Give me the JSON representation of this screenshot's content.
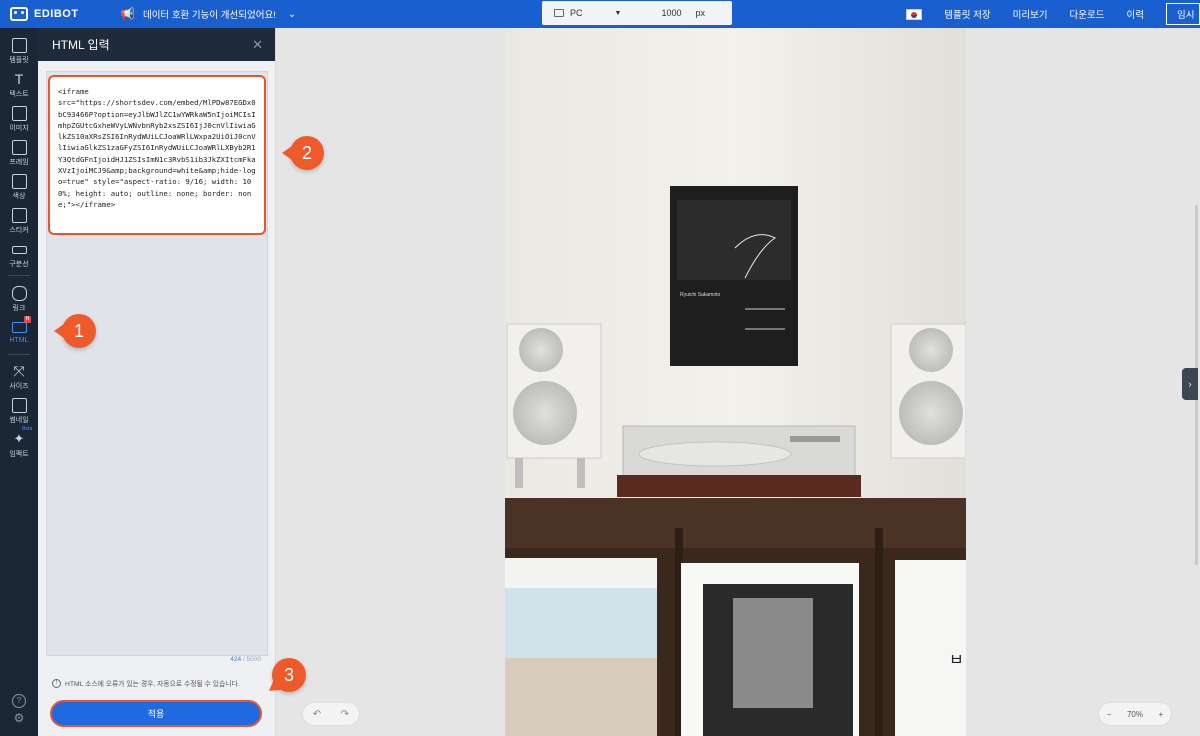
{
  "topbar": {
    "logo": "EDIBOT",
    "notice": "데이터 호환 기능이 개선되었어요!",
    "device": "PC",
    "width_value": "1000",
    "width_unit": "px",
    "actions": [
      "템플릿 저장",
      "미리보기",
      "다운로드",
      "이력",
      "임시"
    ]
  },
  "rail": {
    "items": [
      {
        "label": "템플릿",
        "icon": "template-icon"
      },
      {
        "label": "텍스트",
        "icon": "text-icon"
      },
      {
        "label": "이미지",
        "icon": "image-icon"
      },
      {
        "label": "프레임",
        "icon": "frame-icon"
      },
      {
        "label": "색상",
        "icon": "color-icon"
      },
      {
        "label": "스티커",
        "icon": "sticker-icon"
      },
      {
        "label": "구분선",
        "icon": "divider-icon"
      },
      {
        "label": "링크",
        "icon": "link-icon"
      },
      {
        "label": "HTML",
        "icon": "html-icon"
      },
      {
        "label": "사이즈",
        "icon": "size-icon"
      },
      {
        "label": "썸네일",
        "icon": "thumbnail-icon"
      },
      {
        "label": "임팩트",
        "icon": "impact-icon"
      }
    ],
    "html_badge": "N",
    "impact_badge": "Beta",
    "help": "?"
  },
  "panel": {
    "title": "HTML 입력",
    "code": "<iframe\nsrc=\"https://shortsdev.com/embed/MlPDw87EGDx0bC93466P?option=eyJlbWJlZC1wYWRkaW5nIjoiMCIsImhpZGUtcGxheWVyLWNvbnRyb2xsZSI6IjJ0cnVlIiwiaGlkZS10aXRsZSI6InRydWUiLCJoaWRlLWxpa2UiOiJ0cnVlIiwiaGlkZS1zaGFyZSI6InRydWUiLCJoaWRlLXByb2R1Y3QtdGFnIjoidHJ1ZSIsImN1c3RvbS1ib3JkZXItcmFkaXVzIjoiMCJ9&amp;background=white&amp;hide-logo=true\" style=\"aspect-ratio: 9/16; width: 100%; height: auto; outline: none; border: none;\"></iframe>",
    "count_current": "424",
    "count_max": "/ 5000",
    "info": "HTML 소스에 오류가 있는 경우, 자동으로 수정될 수 있습니다.",
    "info_icon": "!",
    "apply": "적용"
  },
  "callouts": [
    "1",
    "2",
    "3"
  ],
  "canvas": {
    "zoom": "70%",
    "zoom_minus": "−",
    "zoom_plus": "+",
    "undo": "↶",
    "redo": "↷",
    "side_toggle": "›",
    "poster_title": "Ryuichi Sakamoto",
    "album_letters": "ㅂㅂ"
  },
  "colors": {
    "topbar": "#1a5fd0",
    "rail": "#1c2736",
    "accent": "#1f6ae0",
    "callout": "#ee5a2a"
  }
}
